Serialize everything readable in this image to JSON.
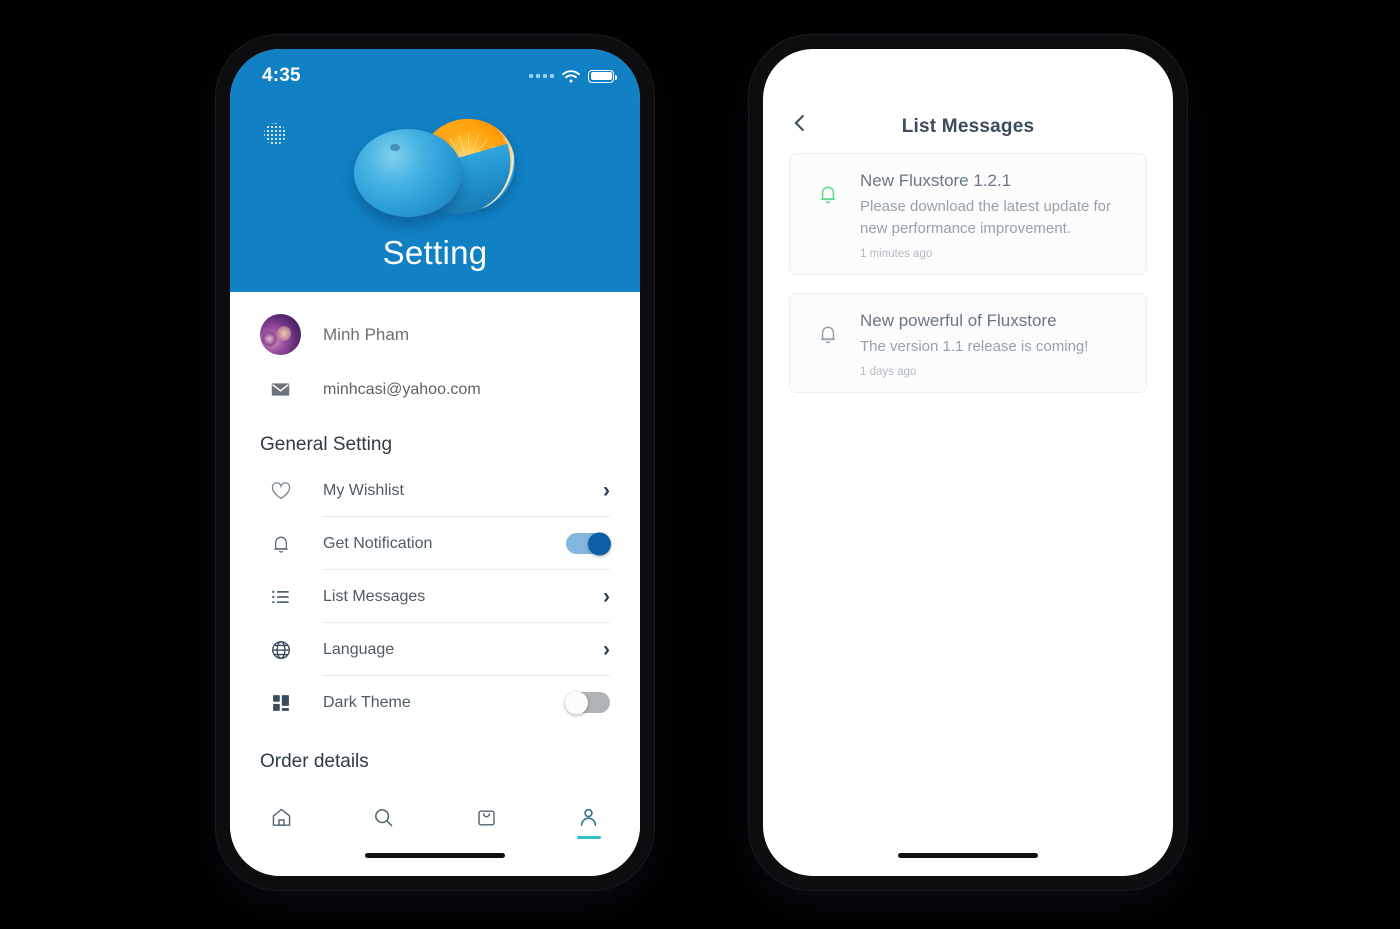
{
  "left_phone": {
    "status_bar": {
      "time": "4:35",
      "wifi_icon": "wifi-icon",
      "battery_icon": "battery-full-icon",
      "signal_icon": "signal-dots-icon"
    },
    "hero": {
      "title": "Setting",
      "background_color": "#1180c4",
      "grid_icon": "dot-grid-icon",
      "image": "blue-painted-orange-photo"
    },
    "profile": {
      "name": "Minh Pham",
      "avatar": "user-avatar-photo",
      "email": "minhcasi@yahoo.com",
      "email_icon": "envelope-icon"
    },
    "general_section_title": "General Setting",
    "settings": [
      {
        "label": "My Wishlist",
        "icon": "heart-icon",
        "control": "chevron",
        "chevron": "›"
      },
      {
        "label": "Get Notification",
        "icon": "bell-icon",
        "control": "switch",
        "value": "on"
      },
      {
        "label": "List Messages",
        "icon": "list-icon",
        "control": "chevron",
        "chevron": "›"
      },
      {
        "label": "Language",
        "icon": "globe-icon",
        "control": "chevron",
        "chevron": "›"
      },
      {
        "label": "Dark Theme",
        "icon": "dashboard-icon",
        "control": "switch",
        "value": "off"
      }
    ],
    "order_section_title": "Order details",
    "tabs": [
      {
        "name": "home",
        "icon": "home-icon",
        "active": false
      },
      {
        "name": "search",
        "icon": "search-icon",
        "active": false
      },
      {
        "name": "cart",
        "icon": "bag-icon",
        "active": false
      },
      {
        "name": "profile",
        "icon": "person-icon",
        "active": true
      }
    ]
  },
  "right_phone": {
    "header": {
      "back_icon": "chevron-left-icon",
      "title": "List Messages"
    },
    "messages": [
      {
        "icon": "bell-icon",
        "icon_color": "#5ddc8f",
        "title": "New Fluxstore 1.2.1",
        "description": "Please download the latest update for new performance improvement.",
        "time": "1 minutes ago"
      },
      {
        "icon": "bell-icon",
        "icon_color": "#9aa3ac",
        "title": "New powerful of Fluxstore",
        "description": "The version 1.1 release is coming!",
        "time": "1 days ago"
      }
    ]
  },
  "colors": {
    "brand_blue": "#1180c4",
    "toggle_on_track": "#84b7dd",
    "toggle_on_knob": "#0b5fa5",
    "toggle_off_track": "#b0b4b8",
    "active_tab_underline": "#2fbfc9",
    "page_background": "#000000"
  }
}
